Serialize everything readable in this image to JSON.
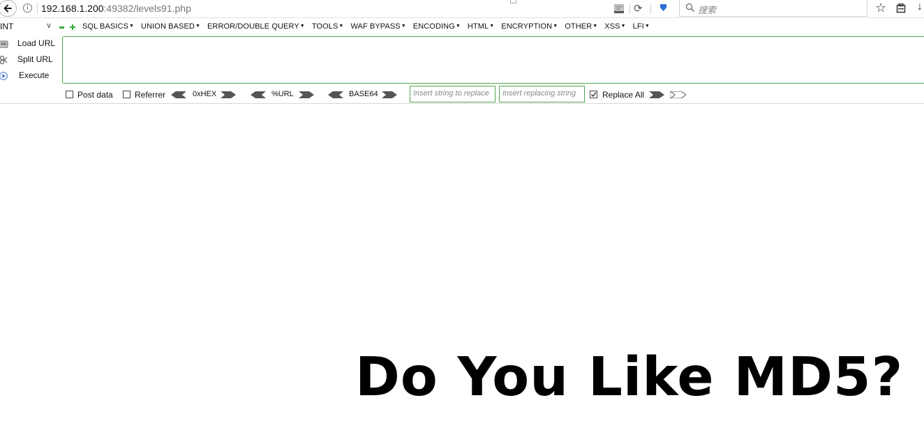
{
  "urlbar": {
    "url_host": "192.168.1.200",
    "url_rest": ":49382/levels91.php",
    "search_placeholder": "搜索",
    "icons": [
      "back-arrow-icon",
      "info-icon",
      "reader-view-icon",
      "reload-icon",
      "pocket-icon",
      "search-icon",
      "star-icon",
      "library-icon",
      "download-icon"
    ]
  },
  "hackbar": {
    "int_select": "INT",
    "menu": [
      "SQL BASICS",
      "UNION BASED",
      "ERROR/DOUBLE QUERY",
      "TOOLS",
      "WAF BYPASS",
      "ENCODING",
      "HTML",
      "ENCRYPTION",
      "OTHER",
      "XSS",
      "LFI"
    ],
    "actions": {
      "load_url": "Load URL",
      "split_url": "Split URL",
      "execute": "Execute"
    },
    "options": {
      "post_data": "Post data",
      "referrer": "Referrer",
      "hex": "0xHEX",
      "url": "%URL",
      "base64": "BASE64",
      "insert_string_placeholder": "Insert string to replace",
      "insert_replacing_placeholder": "Insert replacing string",
      "replace_all": "Replace All",
      "post_data_checked": false,
      "referrer_checked": false,
      "replace_all_checked": true
    }
  },
  "page": {
    "heading": "Do You Like MD5?"
  },
  "colors": {
    "accent_green": "#4ea64e",
    "plus_green": "#2fae2f"
  }
}
